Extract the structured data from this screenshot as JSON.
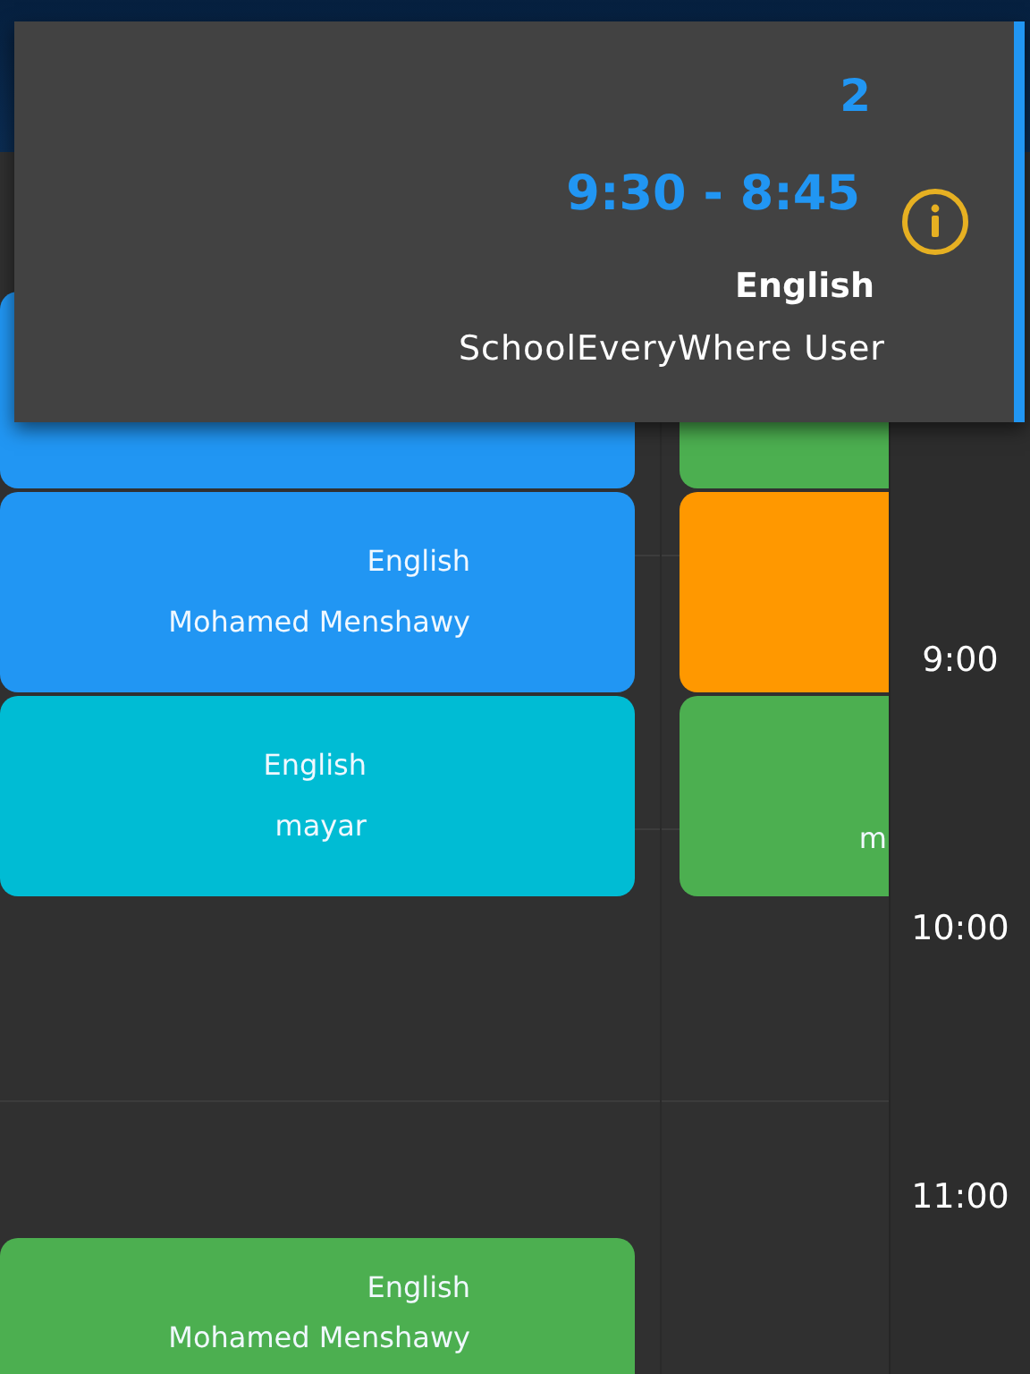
{
  "timeline": {
    "hours": [
      "9:00",
      "10:00",
      "11:00"
    ]
  },
  "columns": [
    {
      "events": [
        {
          "color": "#2196f3"
        },
        {
          "color": "#2196f3",
          "subject": "English",
          "teacher": "Mohamed Menshawy"
        },
        {
          "color": "#00bcd4",
          "subject": "English",
          "teacher": "mayar"
        },
        {
          "color": "#4caf50",
          "subject": "English",
          "teacher": "Mohamed Menshawy"
        }
      ]
    },
    {
      "events": [
        {
          "color": "#4caf50"
        },
        {
          "color": "#ff9800"
        },
        {
          "color": "#4caf50",
          "teacher": "m"
        }
      ]
    }
  ],
  "popup": {
    "number": "2",
    "time": "9:30 - 8:45",
    "subject": "English",
    "user": "SchoolEveryWhere User"
  }
}
